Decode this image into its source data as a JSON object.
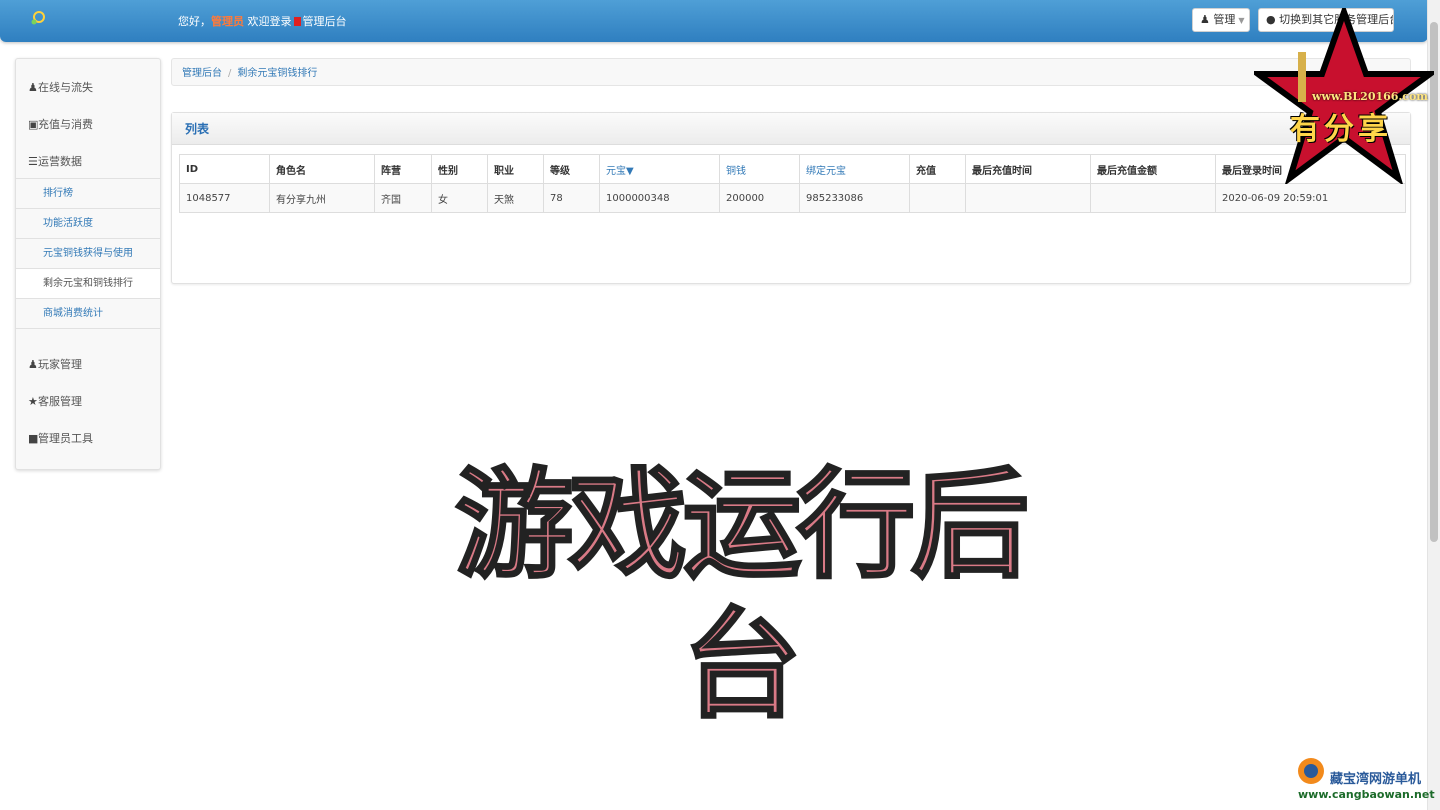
{
  "header": {
    "greeting": "您好，",
    "role_name": "管理员",
    "welcome": "欢迎登录",
    "site_name": "管理后台",
    "manage_label": "管理",
    "switch_label": "切换到其它服务管理后台"
  },
  "sidebar": {
    "items": [
      {
        "label": "在线与流失",
        "icon": "chess-piece-icon"
      },
      {
        "label": "充值与消费",
        "icon": "cart-icon"
      },
      {
        "label": "运营数据",
        "icon": "list-icon"
      },
      {
        "label": "玩家管理",
        "icon": "user-icon"
      },
      {
        "label": "客服管理",
        "icon": "star-icon"
      },
      {
        "label": "管理员工具",
        "icon": "lock-icon"
      }
    ],
    "submenu": [
      {
        "label": "排行榜"
      },
      {
        "label": "功能活跃度"
      },
      {
        "label": "元宝铜钱获得与使用"
      },
      {
        "label": "剩余元宝和铜钱排行"
      },
      {
        "label": "商城消费统计"
      }
    ]
  },
  "breadcrumb": {
    "root": "管理后台",
    "separator": "/",
    "current": "剩余元宝铜钱排行"
  },
  "panel": {
    "title": "列表",
    "columns": [
      "ID",
      "角色名",
      "阵营",
      "性别",
      "职业",
      "等级",
      "元宝▼",
      "铜钱",
      "绑定元宝",
      "充值",
      "最后充值时间",
      "最后充值金额",
      "最后登录时间"
    ],
    "rows": [
      [
        "1048577",
        "有分享九州",
        "齐国",
        "女",
        "天煞",
        "78",
        "1000000348",
        "200000",
        "985233086",
        "",
        "",
        "",
        "2020-06-09 20:59:01"
      ]
    ]
  },
  "overlay": {
    "title": "游戏运行后台"
  },
  "watermark": {
    "url": "www.BL20166.com",
    "brand": "有分享",
    "site_cn": "藏宝湾网游单机",
    "site_url": "www.cangbaowan.net"
  },
  "colors": {
    "header_blue": "#3a8bcb",
    "link_blue": "#337ab7",
    "overlay_pink": "#d97a86"
  }
}
